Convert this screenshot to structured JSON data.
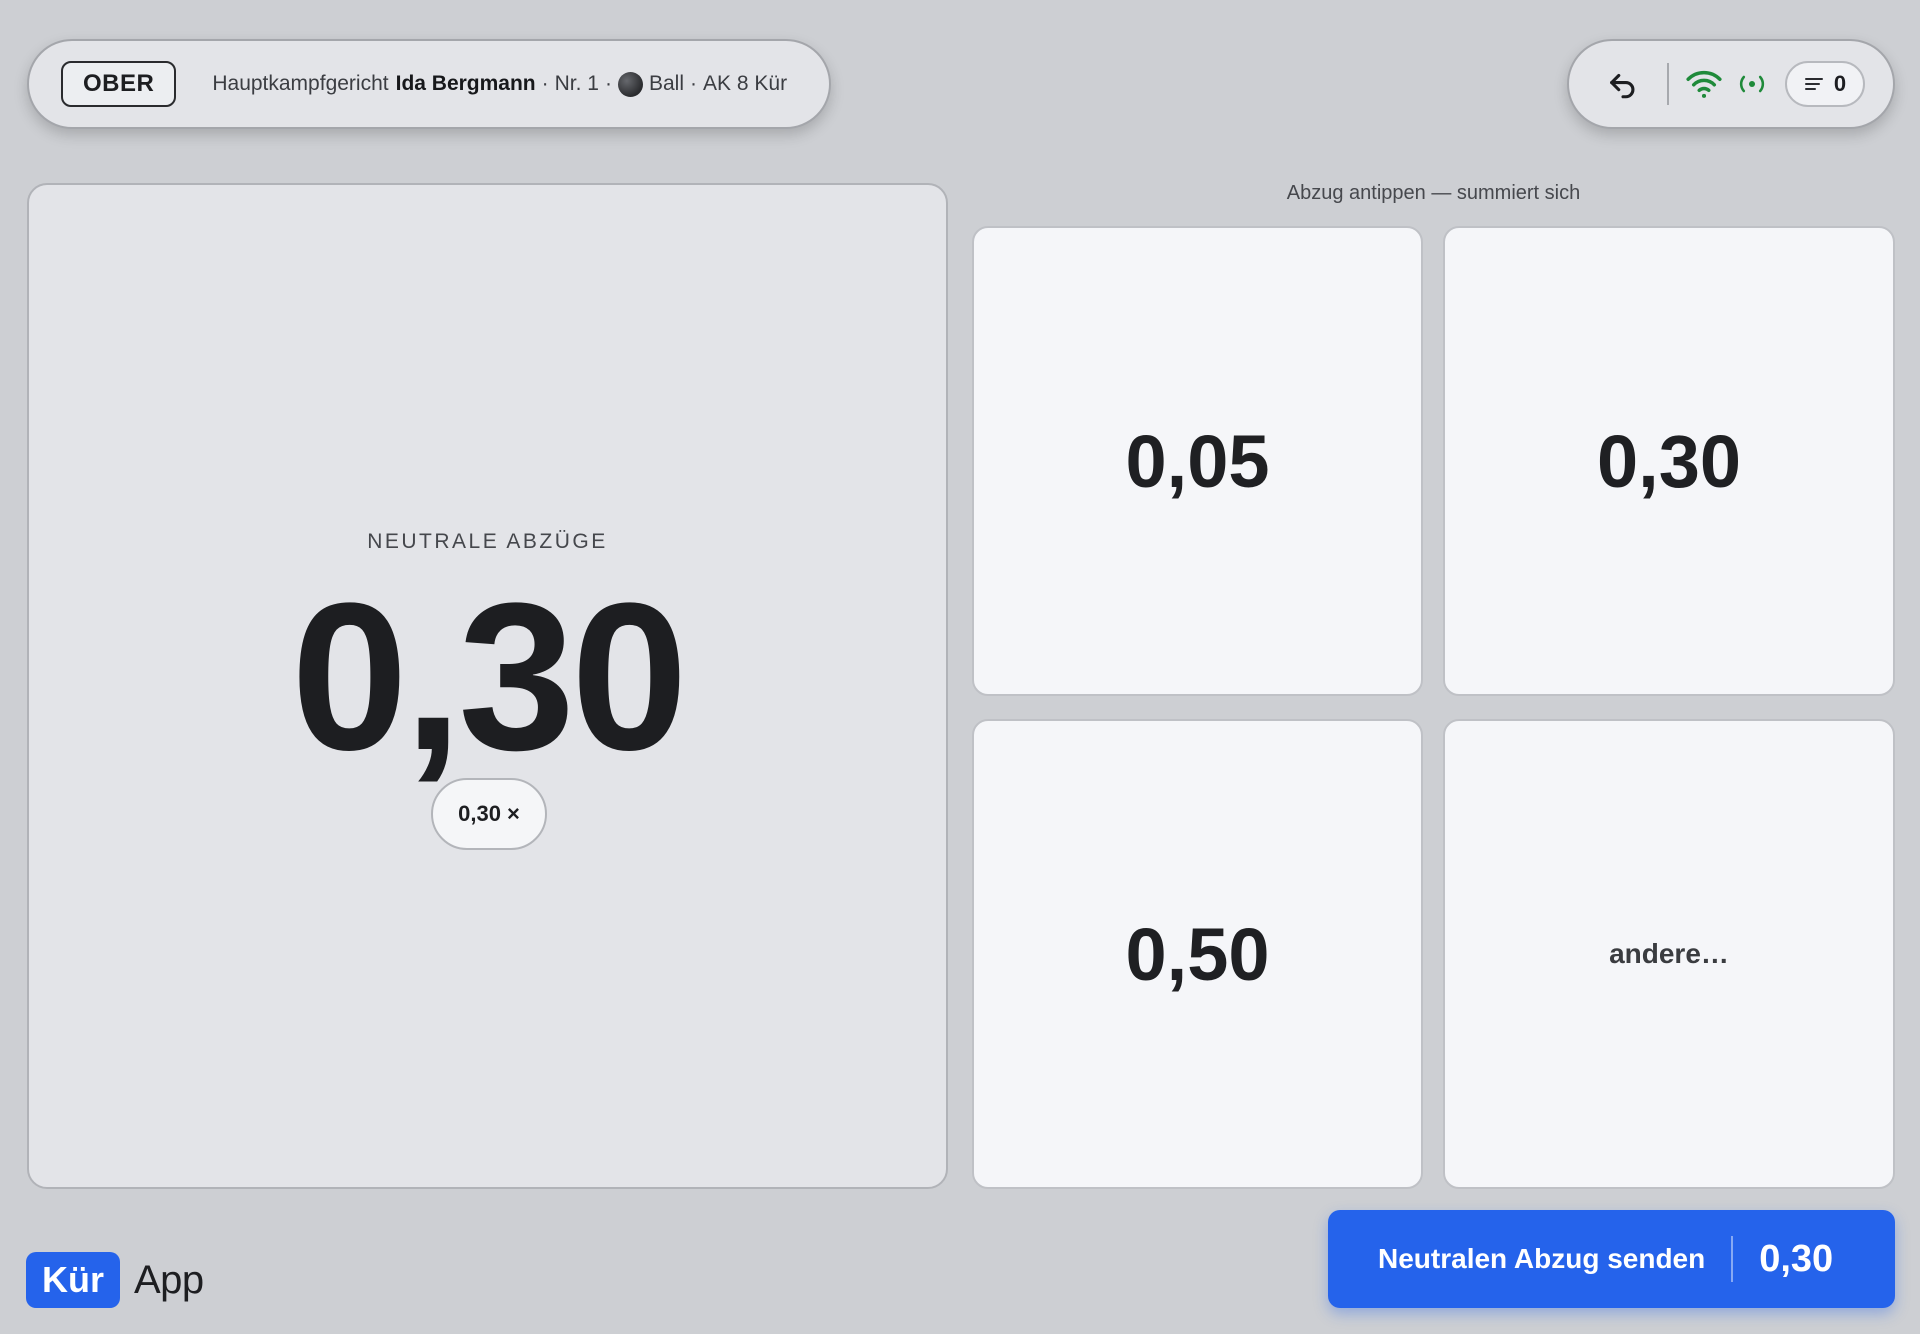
{
  "header": {
    "role": "OBER",
    "panel": "Hauptkampfgericht",
    "athlete": "Ida Bergmann",
    "number": "Nr. 1",
    "apparatus": "Ball",
    "category": "AK 8 Kür"
  },
  "toolbar": {
    "undo_icon": "undo-icon",
    "wifi_icon": "wifi-icon",
    "live_icon": "broadcast-icon",
    "queue_count": "0"
  },
  "total": {
    "label": "NEUTRALE ABZÜGE",
    "value": "0,30",
    "chips": [
      {
        "value": "0,30",
        "remove": "×"
      }
    ]
  },
  "grid": {
    "hint": "Abzug antippen — summiert sich",
    "tiles": [
      "0,05",
      "0,30",
      "0,50",
      "andere…"
    ]
  },
  "brand": {
    "badge": "Kür",
    "text": "App"
  },
  "submit": {
    "label": "Neutralen Abzug senden",
    "value": "0,30"
  },
  "colors": {
    "accent": "#2563eb",
    "online": "#1f8a3a"
  }
}
